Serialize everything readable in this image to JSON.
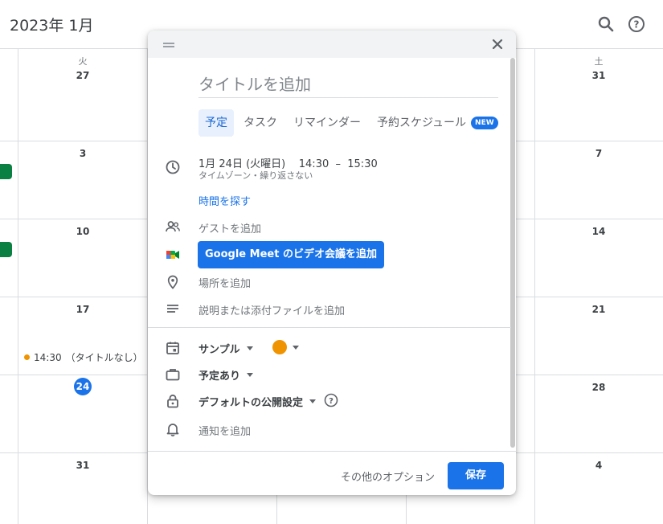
{
  "header": {
    "month_title": "2023年 1月",
    "search_icon": "search-icon",
    "help_icon": "help-icon"
  },
  "calendar": {
    "weekdays": {
      "tue": "火",
      "sat": "土"
    },
    "days": {
      "r1_tue": "27",
      "r1_sat": "31",
      "r2_tue": "3",
      "r2_sat": "7",
      "r3_tue": "10",
      "r3_sat": "14",
      "r4_tue": "17",
      "r4_sat": "21",
      "r5_tue": "24",
      "r5_sat": "28",
      "r6_tue": "31",
      "r6_sat": "4"
    },
    "event": {
      "time": "14:30",
      "title": "（タイトルなし）",
      "color": "#f09300"
    },
    "chip_color": "#0b8043"
  },
  "dialog": {
    "title_placeholder": "タイトルを追加",
    "tabs": [
      {
        "label": "予定",
        "active": true
      },
      {
        "label": "タスク"
      },
      {
        "label": "リマインダー"
      },
      {
        "label": "予約スケジュール",
        "badge": "NEW"
      }
    ],
    "datetime": {
      "date": "1月 24日 (火曜日)",
      "start": "14:30",
      "separator": "–",
      "end": "15:30",
      "sub": "タイムゾーン・繰り返さない"
    },
    "find_time": "時間を探す",
    "add_guests": "ゲストを追加",
    "meet_button": "Google Meet のビデオ会議を追加",
    "add_location": "場所を追加",
    "add_description": "説明または添付ファイルを追加",
    "calendar_select": "サンプル",
    "event_color": "#f09300",
    "busy_select": "予定あり",
    "visibility_select": "デフォルトの公開設定",
    "add_notification": "通知を追加",
    "more_options": "その他のオプション",
    "save": "保存",
    "accent": "#1a73e8"
  }
}
